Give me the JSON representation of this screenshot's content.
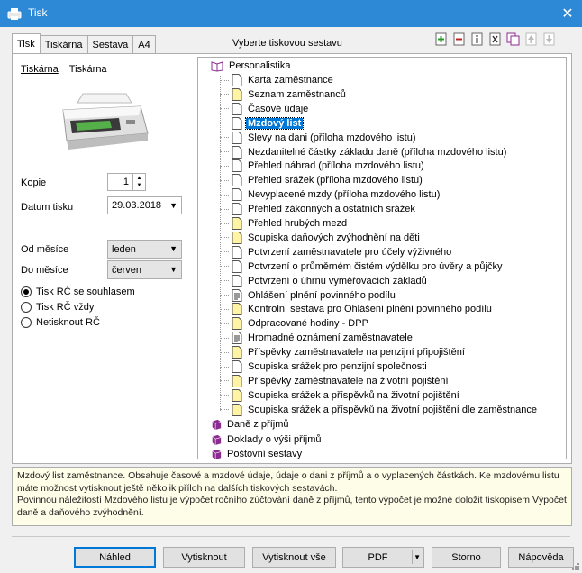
{
  "window": {
    "title": "Tisk"
  },
  "tabs": [
    "Tisk",
    "Tiskárna",
    "Sestava",
    "A4"
  ],
  "report_heading": "Vyberte tiskovou sestavu",
  "printer_tabs": [
    "Tiskárna",
    "Tiskárna"
  ],
  "form": {
    "copies_label": "Kopie",
    "copies_value": "1",
    "date_label": "Datum tisku",
    "date_value": "29.03.2018",
    "from_month_label": "Od měsíce",
    "from_month_value": "leden",
    "to_month_label": "Do měsíce",
    "to_month_value": "červen"
  },
  "rc_options": [
    {
      "label": "Tisk RČ se souhlasem",
      "checked": true
    },
    {
      "label": "Tisk RČ vždy",
      "checked": false
    },
    {
      "label": "Netisknout RČ",
      "checked": false
    }
  ],
  "tree": {
    "root": "Personalistika",
    "items": [
      {
        "label": "Karta zaměstnance",
        "icon": "page-icon"
      },
      {
        "label": "Seznam zaměstnanců",
        "icon": "yellow-page-icon"
      },
      {
        "label": "Časové údaje",
        "icon": "page-icon"
      },
      {
        "label": "Mzdový list",
        "icon": "page-icon",
        "selected": true
      },
      {
        "label": "Slevy na dani (příloha mzdového listu)",
        "icon": "page-icon"
      },
      {
        "label": "Nezdanitelné částky základu daně (příloha mzdového listu)",
        "icon": "page-icon"
      },
      {
        "label": "Přehled náhrad (příloha mzdového listu)",
        "icon": "page-icon"
      },
      {
        "label": "Přehled srážek (příloha mzdového listu)",
        "icon": "page-icon"
      },
      {
        "label": "Nevyplacené mzdy (příloha mzdového listu)",
        "icon": "page-icon"
      },
      {
        "label": "Přehled zákonných a ostatních srážek",
        "icon": "page-icon"
      },
      {
        "label": "Přehled hrubých mezd",
        "icon": "yellow-page-icon"
      },
      {
        "label": "Soupiska daňových zvýhodnění na děti",
        "icon": "yellow-page-icon"
      },
      {
        "label": "Potvrzení zaměstnavatele pro účely výživného",
        "icon": "page-icon"
      },
      {
        "label": "Potvrzení o průměrném čistém výdělku pro úvěry a půjčky",
        "icon": "page-icon"
      },
      {
        "label": "Potvrzení o úhrnu vyměřovacích základů",
        "icon": "page-icon"
      },
      {
        "label": "Ohlášení plnění povinného podílu",
        "icon": "form-icon"
      },
      {
        "label": "Kontrolní sestava pro Ohlášení plnění povinného podílu",
        "icon": "yellow-page-icon"
      },
      {
        "label": "Odpracované hodiny - DPP",
        "icon": "yellow-page-icon"
      },
      {
        "label": "Hromadné oznámení zaměstnavatele",
        "icon": "form-icon"
      },
      {
        "label": "Příspěvky zaměstnavatele na penzijní připojištění",
        "icon": "yellow-page-icon"
      },
      {
        "label": "Soupiska srážek pro penzijní společnosti",
        "icon": "page-icon"
      },
      {
        "label": "Příspěvky zaměstnavatele na životní pojištění",
        "icon": "yellow-page-icon"
      },
      {
        "label": "Soupiska srážek a příspěvků na životní pojištění",
        "icon": "yellow-page-icon"
      },
      {
        "label": "Soupiska srážek a příspěvků na životní pojištění dle zaměstnance",
        "icon": "yellow-page-icon"
      }
    ],
    "groups": [
      "Daně z příjmů",
      "Doklady o výši příjmů",
      "Poštovní sestavy"
    ]
  },
  "description": [
    "Mzdový list zaměstnance. Obsahuje časové a mzdové údaje, údaje o dani z příjmů a o vyplacených částkách. Ke mzdovému listu máte možnost vytisknout ještě několik příloh na dalších tiskových sestavách.",
    "Povinnou náležitostí Mzdového listu je výpočet ročního zúčtování daně z příjmů, tento výpočet je možné doložit tiskopisem Výpočet daně a daňového zvýhodnění."
  ],
  "buttons": {
    "preview": "Náhled",
    "print": "Vytisknout",
    "print_all": "Vytisknout vše",
    "pdf": "PDF",
    "cancel": "Storno",
    "help": "Nápověda"
  },
  "colors": {
    "titlebar": "#2d88d6",
    "selection": "#0078d7",
    "book": "#8b2b8f",
    "yellow_page": "#fff3a6"
  }
}
